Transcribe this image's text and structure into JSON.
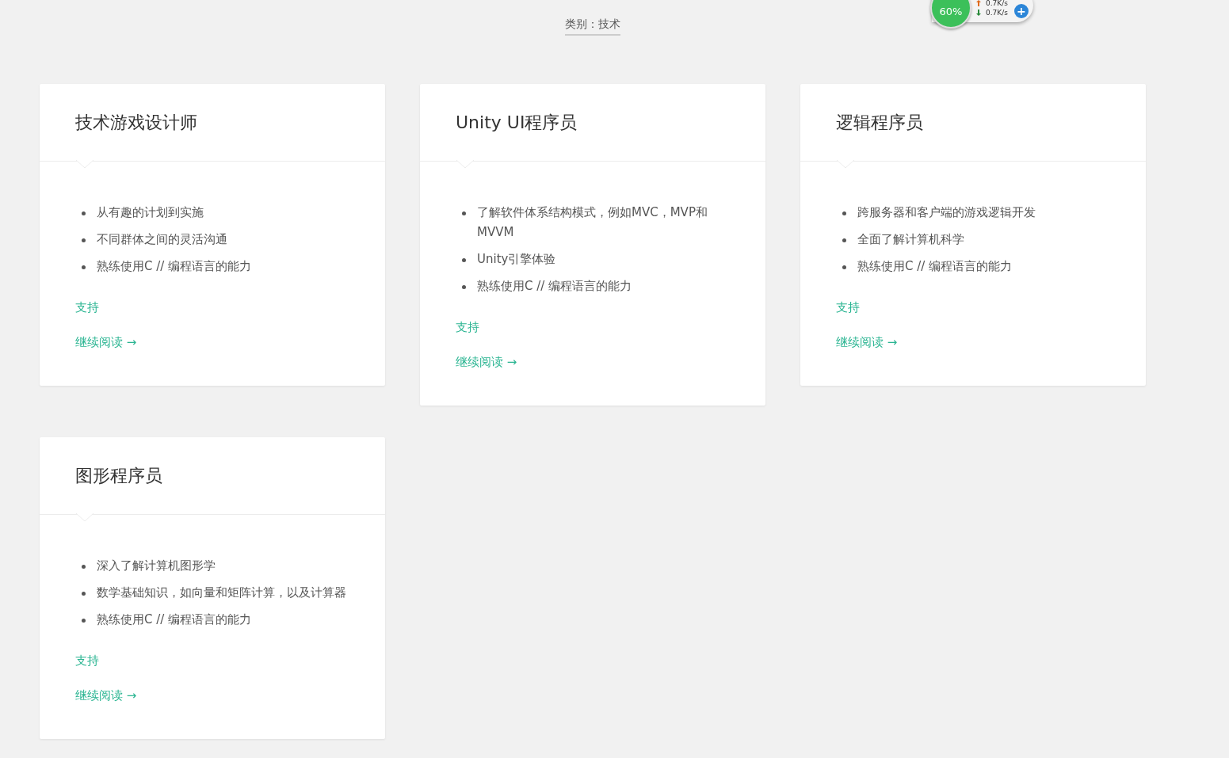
{
  "category": "类别：技术",
  "speed_widget": {
    "percent": "60%",
    "upload": "0.7K/s",
    "download": "0.7K/s",
    "button": "+"
  },
  "cards": [
    {
      "title": "技术游戏设计师",
      "items": [
        "从有趣的计划到实施",
        "不同群体之间的灵活沟通",
        "熟练使用C // 编程语言的能力"
      ],
      "tag": "支持",
      "more": "继续阅读 →"
    },
    {
      "title": "Unity UI程序员",
      "items": [
        "了解软件体系结构模式，例如MVC，MVP和MVVM",
        "Unity引擎体验",
        "熟练使用C // 编程语言的能力"
      ],
      "tag": "支持",
      "more": "继续阅读 →"
    },
    {
      "title": "逻辑程序员",
      "items": [
        "跨服务器和客户端的游戏逻辑开发",
        "全面了解计算机科学",
        "熟练使用C // 编程语言的能力"
      ],
      "tag": "支持",
      "more": "继续阅读 →"
    },
    {
      "title": "图形程序员",
      "items": [
        "深入了解计算机图形学",
        "数学基础知识，如向量和矩阵计算，以及计算器",
        "熟练使用C // 编程语言的能力"
      ],
      "tag": "支持",
      "more": "继续阅读 →"
    }
  ]
}
